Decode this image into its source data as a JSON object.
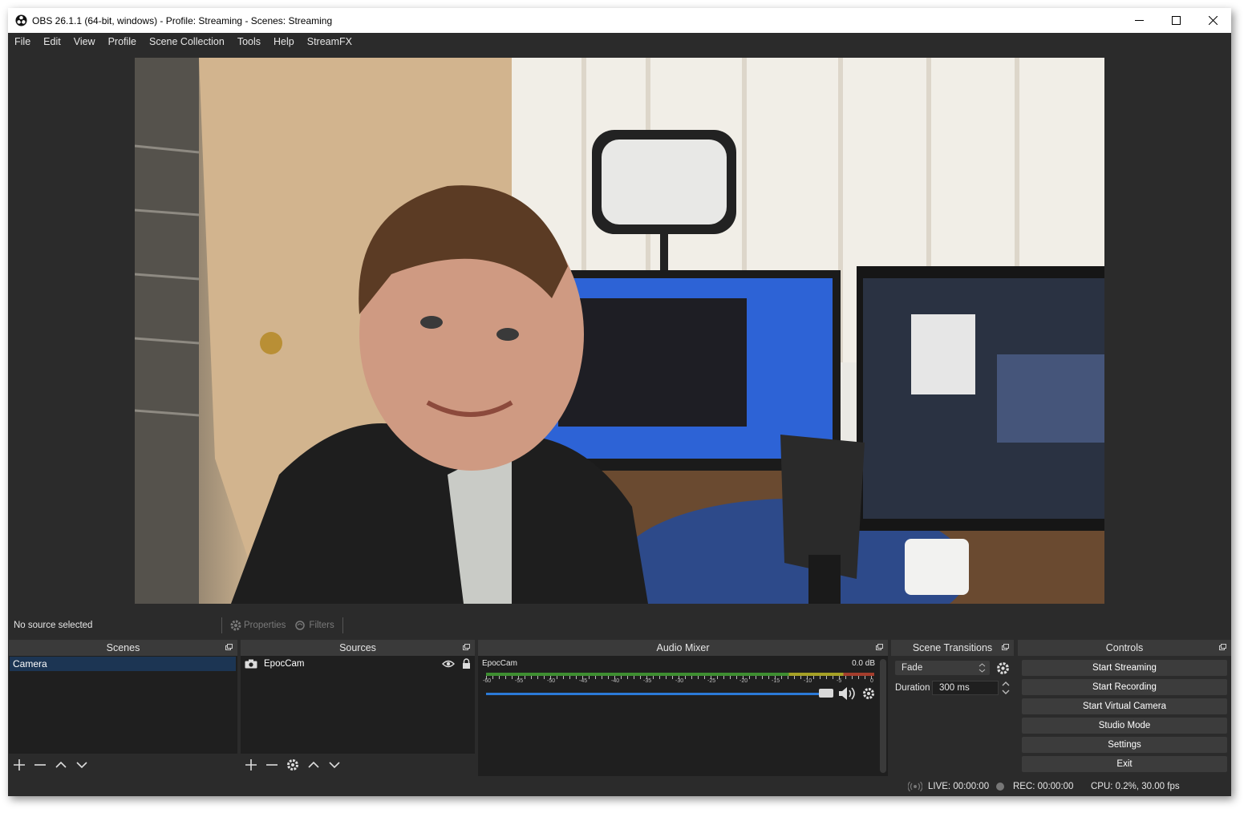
{
  "window": {
    "title": "OBS 26.1.1 (64-bit, windows) - Profile: Streaming - Scenes: Streaming",
    "controls": [
      "minimize-icon",
      "maximize-icon",
      "close-icon"
    ]
  },
  "menu": [
    "File",
    "Edit",
    "View",
    "Profile",
    "Scene Collection",
    "Tools",
    "Help",
    "StreamFX"
  ],
  "source_toolbar": {
    "status": "No source selected",
    "properties": "Properties",
    "filters": "Filters"
  },
  "scenes": {
    "title": "Scenes",
    "items": [
      "Camera"
    ],
    "selected": "Camera"
  },
  "sources": {
    "title": "Sources",
    "items": [
      {
        "name": "EpocCam",
        "icon": "camera-icon",
        "visible": true,
        "locked": true
      }
    ]
  },
  "audio_mixer": {
    "title": "Audio Mixer",
    "channel": {
      "name": "EpocCam",
      "level": "0.0 dB",
      "scale": [
        "-60",
        "-55",
        "-50",
        "-45",
        "-40",
        "-35",
        "-30",
        "-25",
        "-20",
        "-15",
        "-10",
        "-5",
        "0"
      ],
      "volume_fraction": 1.0
    }
  },
  "scene_transitions": {
    "title": "Scene Transitions",
    "transition": "Fade",
    "duration_label": "Duration",
    "duration_value": "300 ms"
  },
  "controls": {
    "title": "Controls",
    "buttons": [
      "Start Streaming",
      "Start Recording",
      "Start Virtual Camera",
      "Studio Mode",
      "Settings",
      "Exit"
    ]
  },
  "status": {
    "live": "LIVE: 00:00:00",
    "rec": "REC: 00:00:00",
    "cpu": "CPU: 0.2%, 30.00 fps"
  },
  "colors": {
    "panel": "#2b2b2b",
    "dock_body": "#1f1f1f",
    "selection": "#1c3553",
    "fader": "#2b7ad8"
  }
}
